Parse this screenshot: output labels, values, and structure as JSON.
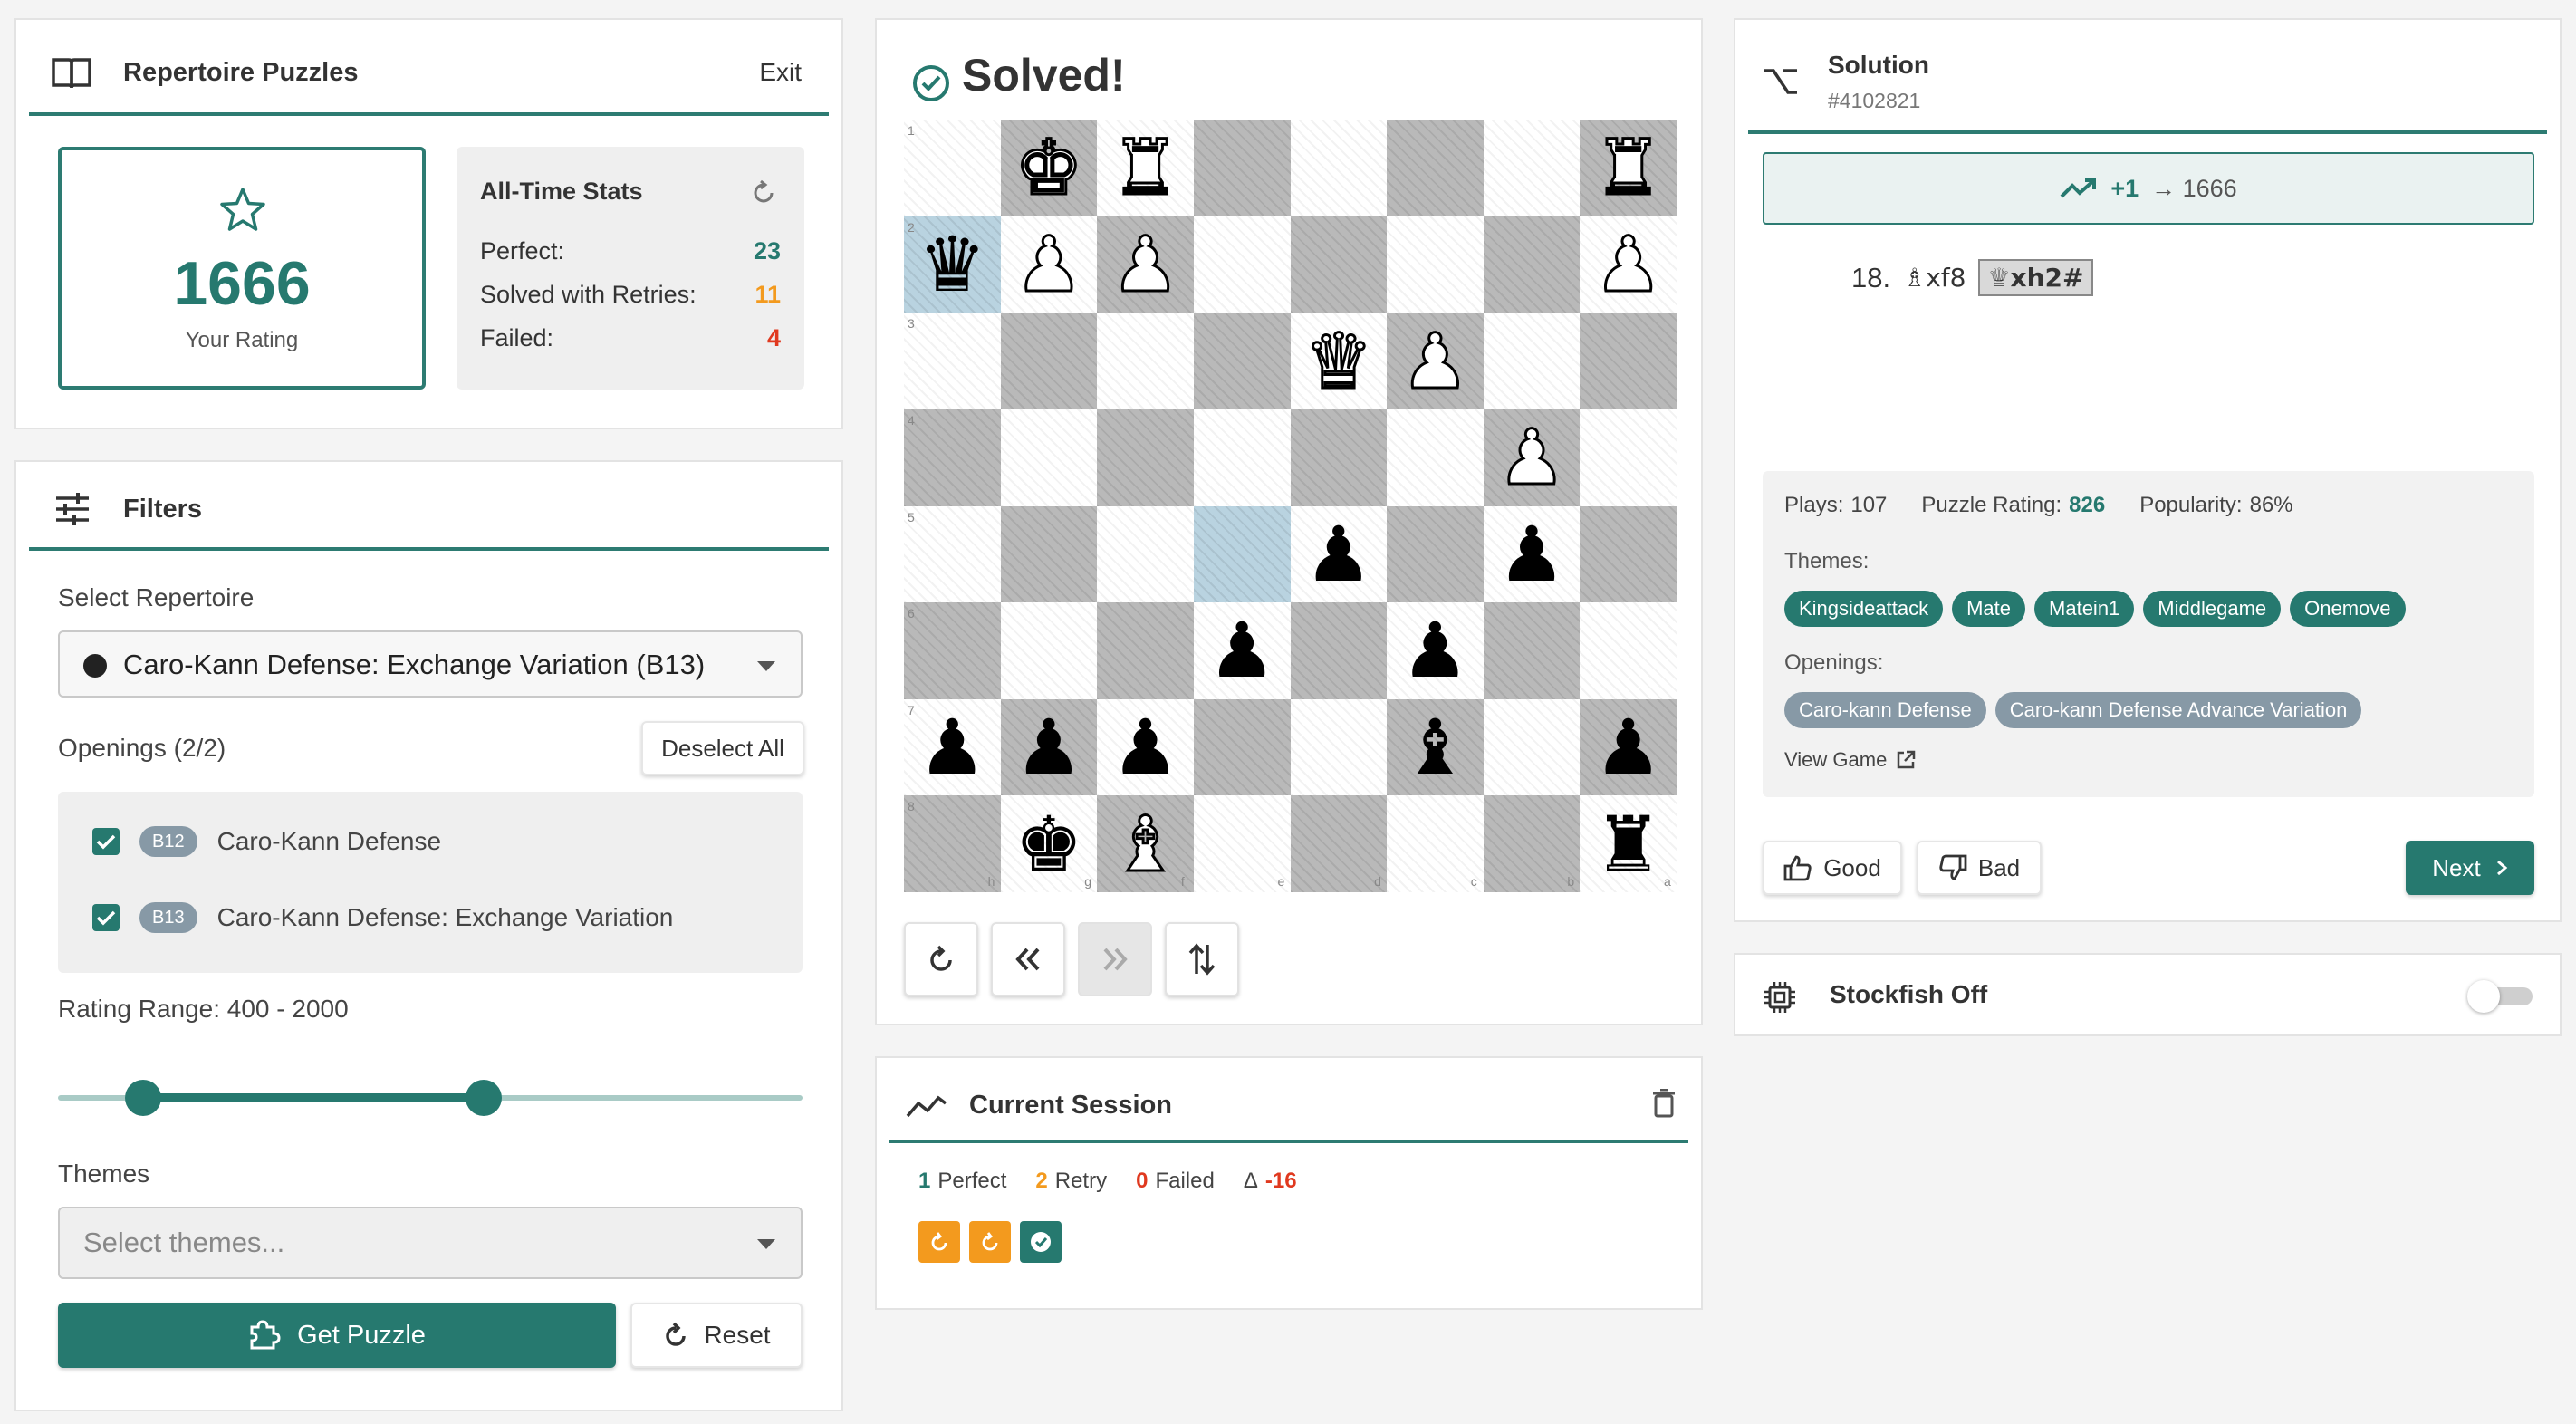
{
  "repertoire_puzzles": {
    "title": "Repertoire Puzzles",
    "exit_label": "Exit",
    "rating": "1666",
    "rating_label": "Your Rating",
    "stats_title": "All-Time Stats",
    "perfect_label": "Perfect:",
    "perfect_value": "23",
    "retries_label": "Solved with Retries:",
    "retries_value": "11",
    "failed_label": "Failed:",
    "failed_value": "4"
  },
  "filters": {
    "title": "Filters",
    "select_repertoire_label": "Select Repertoire",
    "repertoire_value": "Caro-Kann Defense: Exchange Variation (B13)",
    "openings_label": "Openings (2/2)",
    "deselect_all_label": "Deselect All",
    "openings": [
      {
        "eco": "B12",
        "name": "Caro-Kann Defense",
        "checked": true
      },
      {
        "eco": "B13",
        "name": "Caro-Kann Defense: Exchange Variation",
        "checked": true
      }
    ],
    "rating_range_label": "Rating Range: 400 - 2000",
    "rating_min": 400,
    "rating_max": 2000,
    "themes_label": "Themes",
    "themes_placeholder": "Select themes...",
    "get_puzzle_label": "Get Puzzle",
    "reset_label": "Reset"
  },
  "board": {
    "status": "Solved!",
    "rank_labels": [
      "1",
      "2",
      "3",
      "4",
      "5",
      "6",
      "7",
      "8"
    ],
    "file_labels": [
      "h",
      "g",
      "f",
      "e",
      "d",
      "c",
      "b",
      "a"
    ]
  },
  "session": {
    "title": "Current Session",
    "perfect_count": "1",
    "perfect_label": "Perfect",
    "retry_count": "2",
    "retry_label": "Retry",
    "failed_count": "0",
    "failed_label": "Failed",
    "delta_symbol": "Δ",
    "delta_value": "-16"
  },
  "solution": {
    "title": "Solution",
    "puzzle_id": "#4102821",
    "rating_delta": "+1",
    "rating_arrow_text": "→ 1666",
    "move_number": "18.",
    "move_1": "♗xf8",
    "move_2": "♕xh2#",
    "plays_label": "Plays:",
    "plays_value": "107",
    "puzzle_rating_label": "Puzzle Rating:",
    "puzzle_rating_value": "826",
    "popularity_label": "Popularity:",
    "popularity_value": "86%",
    "themes_label": "Themes:",
    "themes": [
      "Kingsideattack",
      "Mate",
      "Matein1",
      "Middlegame",
      "Onemove"
    ],
    "openings_label": "Openings:",
    "openings": [
      "Caro-kann Defense",
      "Caro-kann Defense Advance Variation"
    ],
    "view_game_label": "View Game",
    "good_label": "Good",
    "bad_label": "Bad",
    "next_label": "Next"
  },
  "stockfish": {
    "title": "Stockfish Off",
    "enabled": false
  },
  "colors": {
    "accent": "#26796f",
    "orange": "#f39a1e",
    "red": "#e0391f"
  }
}
